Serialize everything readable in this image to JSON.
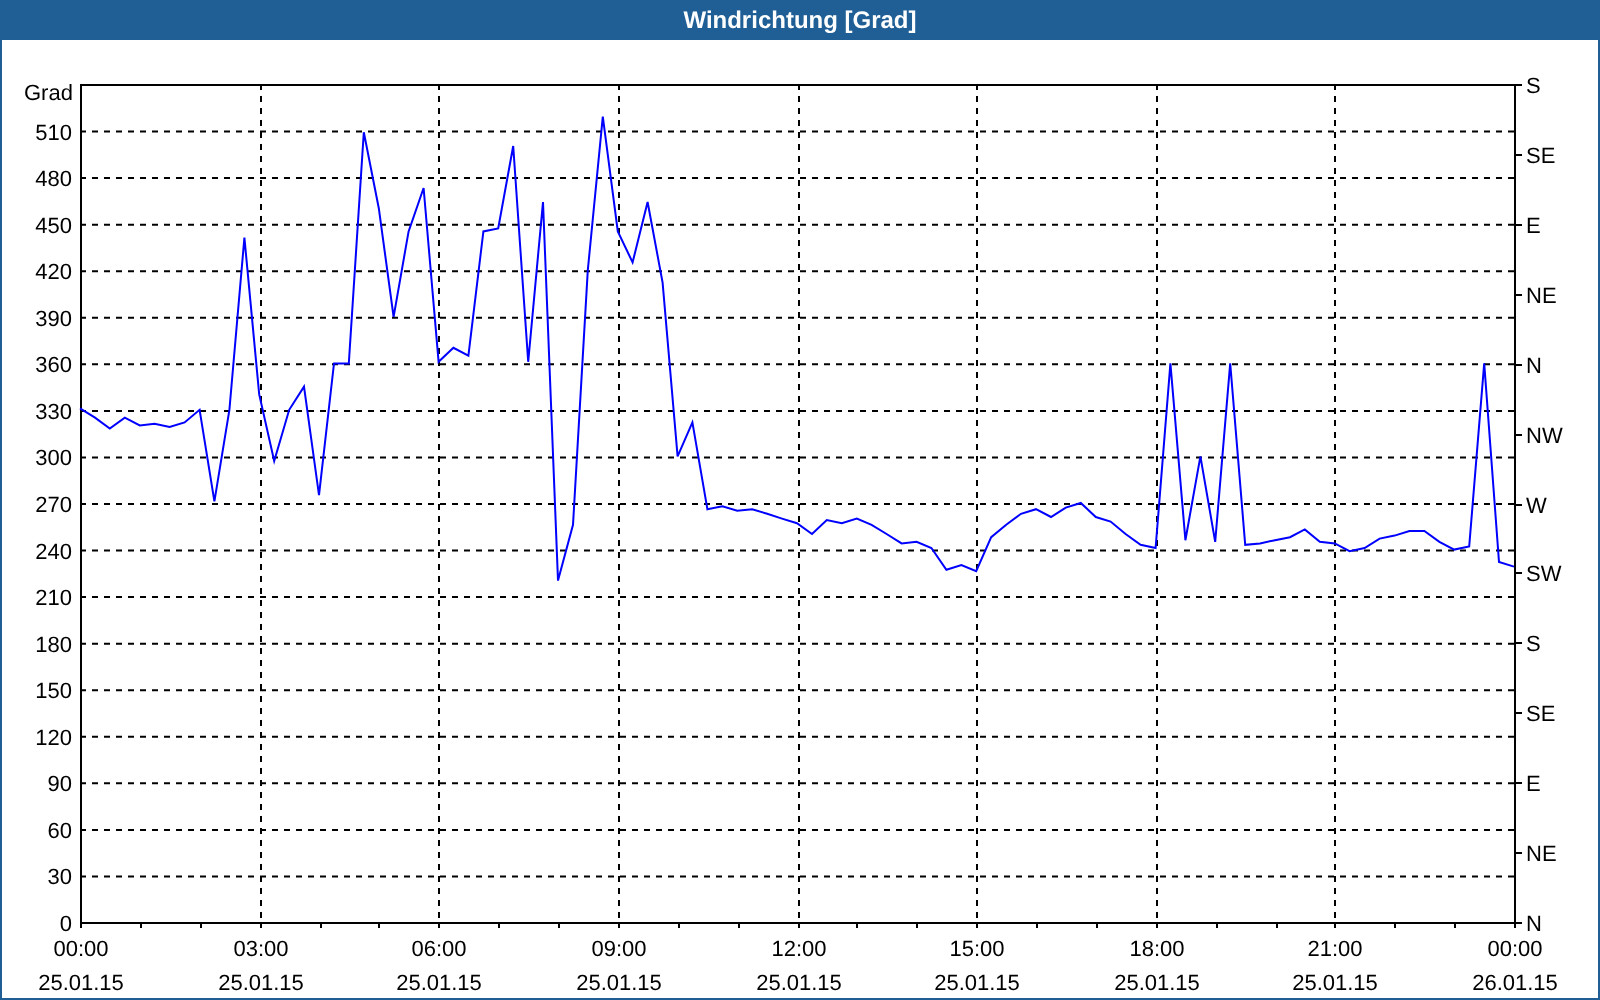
{
  "window": {
    "title": "Windrichtung [Grad]"
  },
  "chart": {
    "chart_data": {
      "type": "line",
      "grid": true,
      "ylabel": "Grad",
      "ylim": [
        0,
        540
      ],
      "yticks": [
        0,
        30,
        60,
        90,
        120,
        150,
        180,
        210,
        240,
        270,
        300,
        330,
        360,
        390,
        420,
        450,
        480,
        510
      ],
      "categories": [
        "00:00 25.01.15",
        null,
        null,
        null,
        null,
        null,
        null,
        null,
        null,
        null,
        null,
        null,
        "03:00 25.01.15",
        null,
        null,
        null,
        null,
        null,
        null,
        null,
        null,
        null,
        null,
        null,
        "06:00 25.01.15",
        null,
        null,
        null,
        null,
        null,
        null,
        null,
        null,
        null,
        null,
        null,
        "09:00 25.01.15",
        null,
        null,
        null,
        null,
        null,
        null,
        null,
        null,
        null,
        null,
        null,
        "12:00 25.01.15",
        null,
        null,
        null,
        null,
        null,
        null,
        null,
        null,
        null,
        null,
        null,
        "15:00 25.01.15",
        null,
        null,
        null,
        null,
        null,
        null,
        null,
        null,
        null,
        null,
        null,
        "18:00 25.01.15",
        null,
        null,
        null,
        null,
        null,
        null,
        null,
        null,
        null,
        null,
        null,
        "21:00 25.01.15",
        null,
        null,
        null,
        null,
        null,
        null,
        null,
        null,
        null,
        null,
        null,
        "00:00 26.01.15"
      ],
      "series": [
        {
          "color": "#0000ff",
          "values": [
            331,
            325,
            318,
            325,
            320,
            321,
            319,
            322,
            330,
            271,
            330,
            441,
            340,
            297,
            330,
            345,
            275,
            360,
            360,
            509,
            460,
            390,
            445,
            473,
            361,
            370,
            365,
            445,
            447,
            500,
            361,
            464,
            220,
            256,
            420,
            519,
            445,
            425,
            464,
            412,
            300,
            322,
            266,
            268,
            265,
            266,
            263,
            260,
            257,
            250,
            259,
            257,
            260,
            256,
            250,
            244,
            245,
            241,
            227,
            230,
            226,
            248,
            256,
            263,
            266,
            261,
            267,
            270,
            261,
            258,
            250,
            243,
            241,
            360,
            246,
            300,
            245,
            360,
            243,
            244,
            246,
            248,
            253,
            245,
            244,
            239,
            241,
            247,
            249,
            252,
            252,
            245,
            240,
            242,
            360,
            232,
            229
          ]
        }
      ]
    },
    "compass_labels": [
      "S",
      "SE",
      "E",
      "NE",
      "N",
      "NW",
      "W",
      "SW",
      "S",
      "SE",
      "E",
      "NE",
      "N"
    ]
  }
}
